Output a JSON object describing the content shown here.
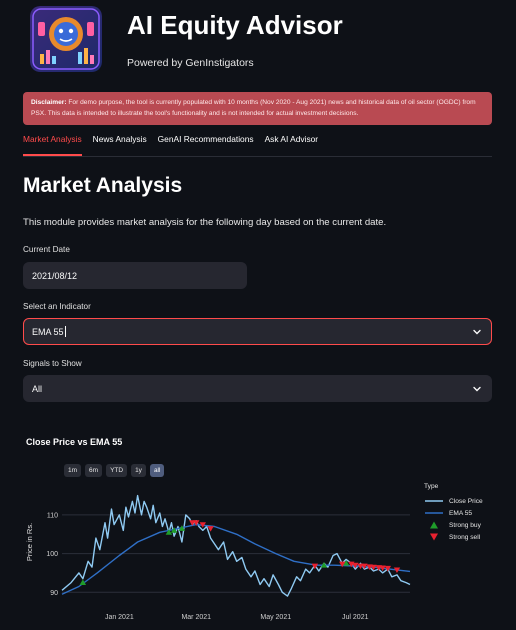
{
  "header": {
    "title": "AI Equity Advisor",
    "subtitle": "Powered by GenInstigators"
  },
  "disclaimer": {
    "label": "Disclaimer:",
    "text": " For demo purpose, the tool is currently populated with 10 months (Nov 2020 - Aug 2021) news and historical data of oil sector (OGDC) from PSX. This data is intended to illustrate the tool's functionality and is not intended for actual investment decisions."
  },
  "tabs": [
    {
      "label": "Market Analysis",
      "active": true
    },
    {
      "label": "News Analysis",
      "active": false
    },
    {
      "label": "GenAI Recommendations",
      "active": false
    },
    {
      "label": "Ask AI Advisor",
      "active": false
    }
  ],
  "page": {
    "title": "Market Analysis",
    "description": "This module provides market analysis for the following day based on the current date."
  },
  "form": {
    "date_label": "Current Date",
    "date_value": "2021/08/12",
    "indicator_label": "Select an Indicator",
    "indicator_value": "EMA 55",
    "signals_label": "Signals to Show",
    "signals_value": "All"
  },
  "colors": {
    "accent": "#ff4b4b",
    "close_line": "#8fcaf2",
    "ema_line": "#2f6fc6",
    "buy": "#1f9d2a",
    "sell": "#e8212f"
  },
  "range_buttons": [
    "1m",
    "6m",
    "YTD",
    "1y",
    "all"
  ],
  "range_active": "all",
  "chart_data": {
    "type": "line",
    "title": "Close Price vs EMA 55",
    "ylabel": "Price in Rs.",
    "xlabel": "",
    "ylim": [
      88,
      118
    ],
    "yticks": [
      90,
      100,
      110
    ],
    "xlim": [
      "2020-11-18",
      "2021-08-12"
    ],
    "xticks": [
      {
        "date": "2021-01-01",
        "label": "Jan 2021"
      },
      {
        "date": "2021-03-01",
        "label": "Mar 2021"
      },
      {
        "date": "2021-05-01",
        "label": "May 2021"
      },
      {
        "date": "2021-07-01",
        "label": "Jul 2021"
      }
    ],
    "legend_title": "Type",
    "legend_position": "right",
    "legend": [
      "Close Price",
      "EMA 55",
      "Strong buy",
      "Strong sell"
    ],
    "series": [
      {
        "name": "Close Price",
        "points": [
          [
            "2020-11-18",
            90.5
          ],
          [
            "2020-11-25",
            92.5
          ],
          [
            "2020-12-01",
            95.0
          ],
          [
            "2020-12-04",
            93.5
          ],
          [
            "2020-12-08",
            98.0
          ],
          [
            "2020-12-11",
            96.5
          ],
          [
            "2020-12-14",
            104.0
          ],
          [
            "2020-12-17",
            101.0
          ],
          [
            "2020-12-21",
            108.0
          ],
          [
            "2020-12-23",
            104.0
          ],
          [
            "2020-12-26",
            111.5
          ],
          [
            "2020-12-28",
            107.5
          ],
          [
            "2021-01-01",
            110.0
          ],
          [
            "2021-01-04",
            106.0
          ],
          [
            "2021-01-06",
            112.0
          ],
          [
            "2021-01-08",
            109.5
          ],
          [
            "2021-01-11",
            113.5
          ],
          [
            "2021-01-13",
            110.5
          ],
          [
            "2021-01-15",
            115.0
          ],
          [
            "2021-01-18",
            110.0
          ],
          [
            "2021-01-20",
            113.5
          ],
          [
            "2021-01-22",
            112.0
          ],
          [
            "2021-01-25",
            109.0
          ],
          [
            "2021-01-27",
            112.5
          ],
          [
            "2021-01-29",
            108.0
          ],
          [
            "2021-02-01",
            110.5
          ],
          [
            "2021-02-03",
            107.0
          ],
          [
            "2021-02-05",
            109.0
          ],
          [
            "2021-02-08",
            105.5
          ],
          [
            "2021-02-10",
            108.0
          ],
          [
            "2021-02-12",
            104.5
          ],
          [
            "2021-02-15",
            107.0
          ],
          [
            "2021-02-18",
            103.0
          ],
          [
            "2021-02-21",
            110.0
          ],
          [
            "2021-02-24",
            109.0
          ],
          [
            "2021-02-26",
            107.5
          ],
          [
            "2021-03-01",
            108.5
          ],
          [
            "2021-03-03",
            107.0
          ],
          [
            "2021-03-06",
            106.0
          ],
          [
            "2021-03-09",
            107.0
          ],
          [
            "2021-03-12",
            104.0
          ],
          [
            "2021-03-15",
            102.5
          ],
          [
            "2021-03-18",
            101.0
          ],
          [
            "2021-03-22",
            103.0
          ],
          [
            "2021-03-25",
            98.5
          ],
          [
            "2021-03-29",
            100.5
          ],
          [
            "2021-04-01",
            98.0
          ],
          [
            "2021-04-05",
            99.0
          ],
          [
            "2021-04-08",
            96.0
          ],
          [
            "2021-04-12",
            94.0
          ],
          [
            "2021-04-15",
            95.5
          ],
          [
            "2021-04-19",
            92.0
          ],
          [
            "2021-04-22",
            93.5
          ],
          [
            "2021-04-26",
            91.5
          ],
          [
            "2021-04-29",
            94.5
          ],
          [
            "2021-05-03",
            92.0
          ],
          [
            "2021-05-06",
            90.0
          ],
          [
            "2021-05-10",
            89.0
          ],
          [
            "2021-05-13",
            91.0
          ],
          [
            "2021-05-17",
            94.0
          ],
          [
            "2021-05-20",
            93.0
          ],
          [
            "2021-05-24",
            96.0
          ],
          [
            "2021-05-27",
            95.0
          ],
          [
            "2021-05-31",
            97.0
          ],
          [
            "2021-06-03",
            95.5
          ],
          [
            "2021-06-07",
            97.5
          ],
          [
            "2021-06-10",
            96.5
          ],
          [
            "2021-06-14",
            99.5
          ],
          [
            "2021-06-17",
            100.0
          ],
          [
            "2021-06-21",
            97.5
          ],
          [
            "2021-06-24",
            98.5
          ],
          [
            "2021-06-28",
            97.5
          ],
          [
            "2021-07-01",
            96.0
          ],
          [
            "2021-07-05",
            97.5
          ],
          [
            "2021-07-08",
            96.0
          ],
          [
            "2021-07-12",
            96.5
          ],
          [
            "2021-07-15",
            95.5
          ],
          [
            "2021-07-19",
            96.0
          ],
          [
            "2021-07-22",
            95.0
          ],
          [
            "2021-07-26",
            96.0
          ],
          [
            "2021-07-29",
            94.0
          ],
          [
            "2021-08-02",
            94.5
          ],
          [
            "2021-08-05",
            93.0
          ],
          [
            "2021-08-09",
            92.5
          ],
          [
            "2021-08-12",
            92.0
          ]
        ]
      },
      {
        "name": "EMA 55",
        "points": [
          [
            "2020-11-18",
            89.5
          ],
          [
            "2020-12-01",
            91.5
          ],
          [
            "2020-12-15",
            95.0
          ],
          [
            "2021-01-01",
            99.5
          ],
          [
            "2021-01-15",
            103.0
          ],
          [
            "2021-02-01",
            105.5
          ],
          [
            "2021-02-15",
            106.5
          ],
          [
            "2021-03-01",
            107.5
          ],
          [
            "2021-03-15",
            107.0
          ],
          [
            "2021-04-01",
            105.0
          ],
          [
            "2021-04-15",
            102.5
          ],
          [
            "2021-05-01",
            100.0
          ],
          [
            "2021-05-15",
            98.0
          ],
          [
            "2021-06-01",
            97.0
          ],
          [
            "2021-06-15",
            97.0
          ],
          [
            "2021-07-01",
            96.8
          ],
          [
            "2021-07-15",
            96.5
          ],
          [
            "2021-08-01",
            95.8
          ],
          [
            "2021-08-12",
            95.4
          ]
        ]
      },
      {
        "name": "Strong buy",
        "points": [
          [
            "2020-12-04",
            92.5
          ],
          [
            "2021-02-08",
            105.5
          ],
          [
            "2021-02-12",
            106.0
          ],
          [
            "2021-02-18",
            106.5
          ],
          [
            "2021-06-07",
            97.0
          ],
          [
            "2021-06-24",
            97.5
          ]
        ]
      },
      {
        "name": "Strong sell",
        "points": [
          [
            "2021-02-26",
            108.0
          ],
          [
            "2021-03-01",
            108.0
          ],
          [
            "2021-03-06",
            107.5
          ],
          [
            "2021-03-12",
            106.5
          ],
          [
            "2021-05-31",
            96.8
          ],
          [
            "2021-06-21",
            97.3
          ],
          [
            "2021-06-28",
            97.3
          ],
          [
            "2021-07-01",
            97.0
          ],
          [
            "2021-07-05",
            96.8
          ],
          [
            "2021-07-08",
            96.8
          ],
          [
            "2021-07-12",
            96.6
          ],
          [
            "2021-07-15",
            96.5
          ],
          [
            "2021-07-19",
            96.4
          ],
          [
            "2021-07-22",
            96.3
          ],
          [
            "2021-07-26",
            96.2
          ],
          [
            "2021-08-02",
            95.8
          ]
        ]
      }
    ]
  }
}
